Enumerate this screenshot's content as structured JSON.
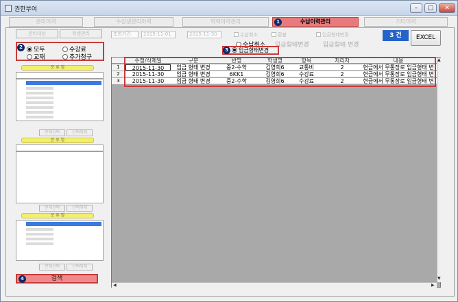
{
  "window": {
    "title": "권한부여"
  },
  "top_tabs": [
    {
      "label": "관리이력"
    },
    {
      "label": "수강생관리이력"
    },
    {
      "label": "학적이력관리"
    },
    {
      "label": "수납이력관리",
      "badge": "1"
    },
    {
      "label": "기타이력"
    }
  ],
  "left": {
    "subtabs": [
      "관리대상",
      "학생관리"
    ],
    "radio_badge": "2",
    "radios": [
      {
        "label": "모두",
        "checked": true
      },
      {
        "label": "수강료",
        "checked": false
      },
      {
        "label": "교재",
        "checked": false
      },
      {
        "label": "추가청구",
        "checked": false
      }
    ],
    "section_labels": [
      "분 류 별",
      "분 류 별",
      "분 류 별"
    ],
    "blur_buttons": [
      "전체선택",
      "선택해제",
      "전체선택",
      "선택해제",
      "전체선택",
      "선택해제"
    ],
    "search": {
      "badge": "4",
      "label": "검색"
    }
  },
  "filters": {
    "date_label": "조회기간",
    "date_from": "2015-11-01",
    "date_to": "2015-11-30",
    "check1": "수납취소",
    "check2": "환불",
    "check3": "입금형태변경"
  },
  "options": {
    "opt1": "수납취소",
    "opt2": "입금형태변경",
    "opt3": "입금형태 변경",
    "badge": "3",
    "selected": "입금형태변경"
  },
  "count_label": "3 건",
  "excel_label": "EXCEL",
  "grid": {
    "headers": [
      "수정/삭제일",
      "구분",
      "반명",
      "학생명",
      "항목",
      "처리자",
      "내용"
    ],
    "rows": [
      {
        "num": "1",
        "cells": [
          "2015-11-30",
          "입금 형태 변경",
          "중2-수학",
          "김영희6",
          "교통비",
          "2",
          "현금에서 무통장로 입금형태 변"
        ]
      },
      {
        "num": "2",
        "cells": [
          "2015-11-30",
          "입금 형태 변경",
          "6KK1",
          "김영희6",
          "수강료",
          "2",
          "현금에서 무통장로 입금형태 변"
        ]
      },
      {
        "num": "3",
        "cells": [
          "2015-11-30",
          "입금 형태 변경",
          "중2-수학",
          "김영희6",
          "수강료",
          "2",
          "현금에서 무통장로 입금형태 변"
        ]
      }
    ]
  }
}
